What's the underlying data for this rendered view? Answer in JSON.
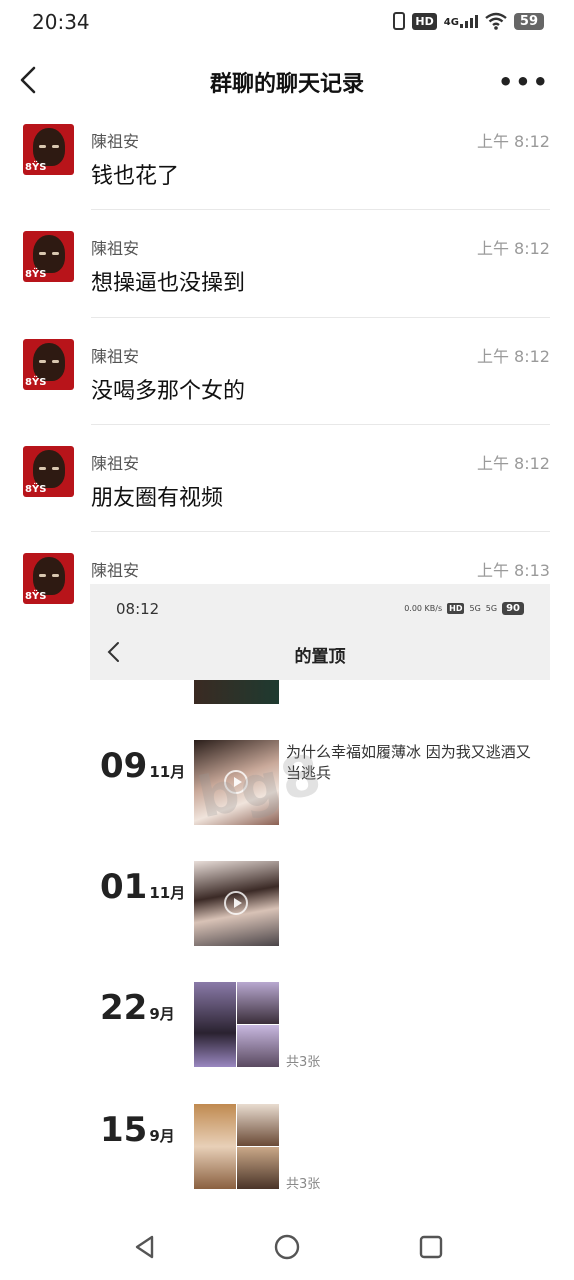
{
  "status_bar": {
    "time": "20:34",
    "hd": "HD",
    "network": "4G",
    "battery": "59"
  },
  "nav": {
    "title": "群聊的聊天记录",
    "more": "•••"
  },
  "messages": [
    {
      "sender": "陳祖安",
      "time": "上午 8:12",
      "text": "钱也花了"
    },
    {
      "sender": "陳祖安",
      "time": "上午 8:12",
      "text": "想操逼也没操到"
    },
    {
      "sender": "陳祖安",
      "time": "上午 8:12",
      "text": "没喝多那个女的"
    },
    {
      "sender": "陳祖安",
      "time": "上午 8:12",
      "text": "朋友圈有视频"
    },
    {
      "sender": "陳祖安",
      "time": "上午 8:13",
      "text": ""
    }
  ],
  "shared_screenshot": {
    "time": "08:12",
    "speed": "0.00 KB/s",
    "hd": "HD",
    "net1": "5G",
    "net2": "5G",
    "battery": "90",
    "title": "的置顶",
    "watermark": "bg8",
    "entries": [
      {
        "day": "09",
        "month": "11月",
        "caption": "为什么幸福如履薄冰 因为我又逃酒又当逃兵",
        "count": ""
      },
      {
        "day": "01",
        "month": "11月",
        "caption": "",
        "count": ""
      },
      {
        "day": "22",
        "month": "9月",
        "caption": "",
        "count": "共3张"
      },
      {
        "day": "15",
        "month": "9月",
        "caption": "",
        "count": "共3张"
      }
    ]
  },
  "colors": {
    "avatar_red": "#b8141a",
    "divider": "#e8e8e8",
    "time_gray": "#9a9a9a"
  },
  "icons": [
    "back-icon",
    "more-icon",
    "play-icon",
    "nav-back-triangle-icon",
    "nav-home-circle-icon",
    "nav-recents-square-icon"
  ]
}
